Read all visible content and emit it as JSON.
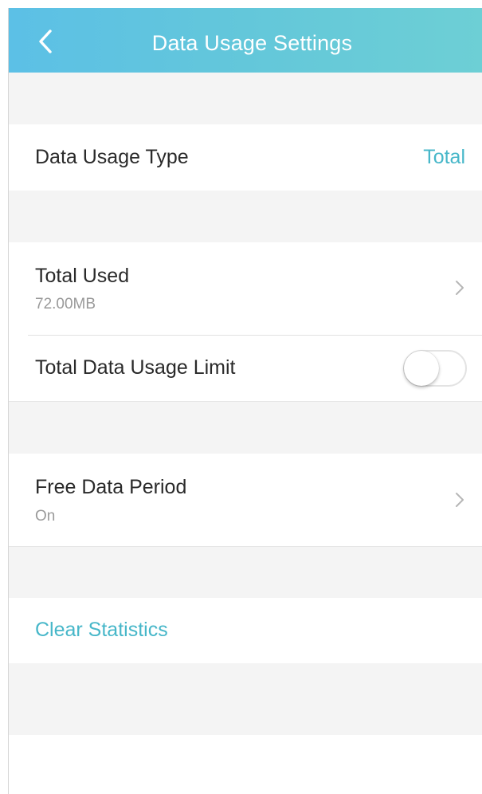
{
  "header": {
    "title": "Data Usage Settings",
    "back_icon": "chevron-left-icon"
  },
  "data_usage_type": {
    "label": "Data Usage Type",
    "value": "Total"
  },
  "total_used": {
    "label": "Total Used",
    "value": "72.00MB",
    "icon": "chevron-right-icon"
  },
  "data_limit": {
    "label": "Total Data Usage Limit",
    "enabled": false
  },
  "free_period": {
    "label": "Free Data Period",
    "value": "On",
    "icon": "chevron-right-icon"
  },
  "clear": {
    "label": "Clear Statistics"
  },
  "colors": {
    "accent": "#47b7c9",
    "header_start": "#5cc0e6",
    "header_end": "#6dcfd5",
    "group_background": "#f4f4f4"
  }
}
